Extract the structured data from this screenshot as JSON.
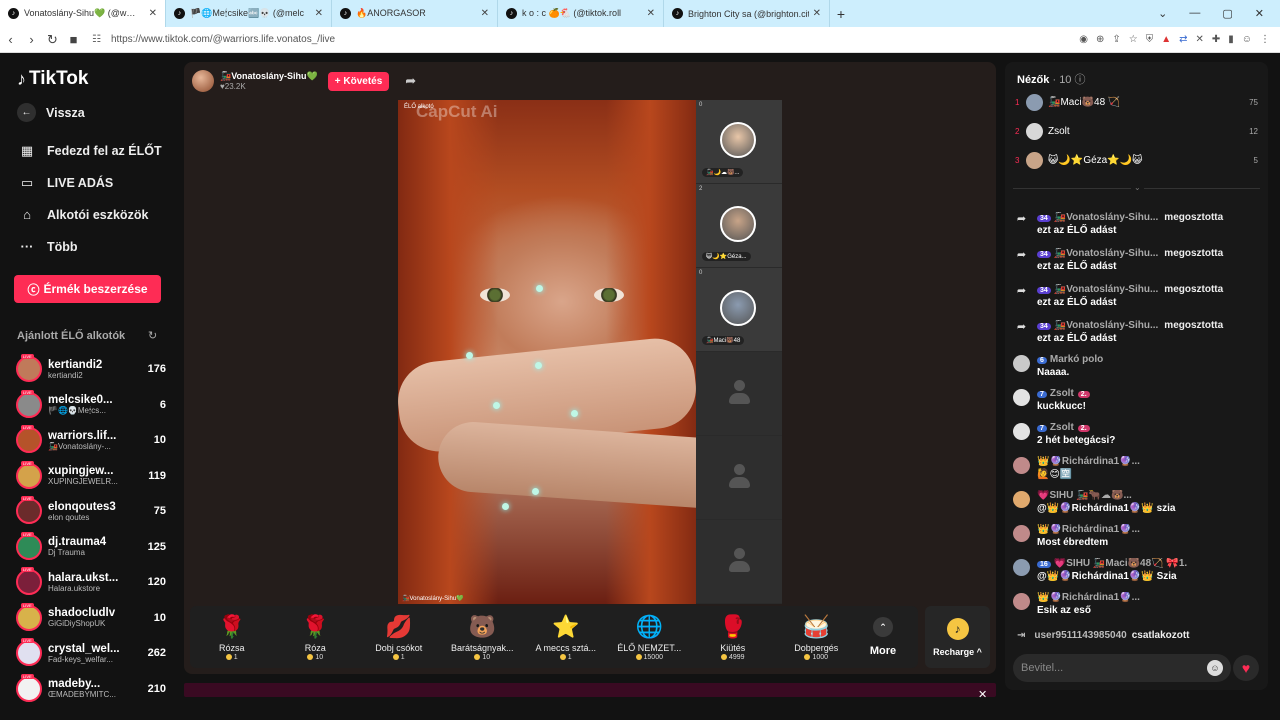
{
  "browser": {
    "tabs": [
      {
        "title": "Vonatoslány-Sihu💚 (@w…",
        "active": true
      },
      {
        "title": "🏴🌐Me🕯csike🔤💀 (@melc",
        "active": false
      },
      {
        "title": "🔥ANORGASOR",
        "active": false
      },
      {
        "title": "k o : c 🍊🐔 (@tiktok.roll",
        "active": false
      },
      {
        "title": "Brighton City sa (@brighton.city) ÉLŐ",
        "active": false
      }
    ],
    "new_tab": "+",
    "url": "https://www.tiktok.com/@warriors.life.vonatos_/live"
  },
  "sidebar": {
    "logo": "TikTok",
    "back": "Vissza",
    "nav": [
      {
        "label": "Fedezd fel az ÉLŐT",
        "icon": "calendar-icon"
      },
      {
        "label": "LIVE ADÁS",
        "icon": "video-camera-icon"
      },
      {
        "label": "Alkotói eszközök",
        "icon": "home-tools-icon"
      },
      {
        "label": "Több",
        "icon": "ellipsis-icon"
      }
    ],
    "coins_button": "Érmék beszerzése",
    "recommended_title": "Ajánlott ÉLŐ alkotók",
    "creators": [
      {
        "name": "kertiandi2",
        "sub": "kertiandi2",
        "count": "176",
        "color": "#c07a5a"
      },
      {
        "name": "melcsike0...",
        "sub": "🏴🌐💀Me🕯cs...",
        "count": "6",
        "color": "#8a8a8a"
      },
      {
        "name": "warriors.lif...",
        "sub": "🚂Vonatoslány-...",
        "count": "10",
        "color": "#b5532a"
      },
      {
        "name": "xupingjew...",
        "sub": "XUPINGJEWELR...",
        "count": "119",
        "color": "#d4a24a"
      },
      {
        "name": "elonqoutes3",
        "sub": "elon qoutes",
        "count": "75",
        "color": "#6b2b2b"
      },
      {
        "name": "dj.trauma4",
        "sub": "Dj Trauma",
        "count": "125",
        "color": "#2e8b57"
      },
      {
        "name": "halara.ukst...",
        "sub": "Halara.ukstore",
        "count": "120",
        "color": "#7b1f3a"
      },
      {
        "name": "shadocludlv",
        "sub": "GiGiDiyShopUK",
        "count": "10",
        "color": "#d8b24a"
      },
      {
        "name": "crystal_wel...",
        "sub": "Fad-keys_welfar...",
        "count": "262",
        "color": "#e0e0f0"
      },
      {
        "name": "madeby...",
        "sub": "ŒMADEBYMITC...",
        "count": "210",
        "color": "#f2f2f2"
      }
    ]
  },
  "stream": {
    "host_name": "🚂Vonatoslány-Sihu💚",
    "host_followers": "♥23.2K",
    "follow_button": "+ Követés",
    "live_label": "ÉLŐ alkotó",
    "watermark": "CapCut Ai",
    "video_footer": "🚂Vonatoslány-Sihu💚",
    "guests": [
      {
        "count": "0",
        "name": "🚂🌙☁🐻...",
        "color": "#e8c6a8"
      },
      {
        "count": "2",
        "name": "😺🌙⭐Géza...",
        "color": "#c8a488"
      },
      {
        "count": "0",
        "name": "🚂Maci🐻48",
        "color": "#8b9bb0"
      }
    ]
  },
  "gifts": [
    {
      "name": "Rózsa",
      "price": "1",
      "icon": "🌹"
    },
    {
      "name": "Róza",
      "price": "10",
      "icon": "🌹"
    },
    {
      "name": "Dobj csókot",
      "price": "1",
      "icon": "💋"
    },
    {
      "name": "Barátságnyak...",
      "price": "10",
      "icon": "🐻"
    },
    {
      "name": "A meccs sztá...",
      "price": "1",
      "icon": "⭐"
    },
    {
      "name": "ÉLŐ NEMZET...",
      "price": "15000",
      "icon": "🌐"
    },
    {
      "name": "Kiütés",
      "price": "4999",
      "icon": "🥊"
    },
    {
      "name": "Dobpergés",
      "price": "1000",
      "icon": "🥁"
    }
  ],
  "more_label": "More",
  "recharge_label": "Recharge ^",
  "viewers": {
    "title": "Nézők",
    "count": "· 10",
    "top": [
      {
        "rank": "1",
        "name": "🚂Maci🐻48 🏹",
        "score": "75",
        "color": "#8b9bb0"
      },
      {
        "rank": "2",
        "name": "Zsolt",
        "score": "12",
        "color": "#d8d8d8"
      },
      {
        "rank": "3",
        "name": "😺🌙⭐Géza⭐🌙😺",
        "score": "5",
        "color": "#c8a488"
      }
    ]
  },
  "chat": [
    {
      "type": "share",
      "level": "34",
      "user": "🚂Vonatoslány-Sihu...",
      "action": "megosztotta",
      "text": "ezt az ÉLŐ adást"
    },
    {
      "type": "share",
      "level": "34",
      "user": "🚂Vonatoslány-Sihu...",
      "action": "megosztotta",
      "text": "ezt az ÉLŐ adást"
    },
    {
      "type": "share",
      "level": "34",
      "user": "🚂Vonatoslány-Sihu...",
      "action": "megosztotta",
      "text": "ezt az ÉLŐ adást"
    },
    {
      "type": "share",
      "level": "34",
      "user": "🚂Vonatoslány-Sihu...",
      "action": "megosztotta",
      "text": "ezt az ÉLŐ adást"
    },
    {
      "type": "msg",
      "level": "6",
      "user": "Markó polo",
      "text": "Naaaa.",
      "color": "#c9c9c9"
    },
    {
      "type": "msg",
      "level": "7",
      "user": "Zsolt",
      "fan": "2.",
      "text": "kuckkucc!",
      "color": "#e2e2e2"
    },
    {
      "type": "msg",
      "level": "7",
      "user": "Zsolt",
      "fan": "2.",
      "text": "2 hét betegácsi?",
      "color": "#e2e2e2"
    },
    {
      "type": "msg",
      "level": "",
      "user": "👑🔮Richárdina1🔮...",
      "text": "🙋😊🈳",
      "color": "#c08a8a"
    },
    {
      "type": "msg",
      "level": "",
      "user": "💗SIHU 🚂🐂☁🐻...",
      "text": "@👑🔮Richárdina1🔮👑 szia",
      "color": "#e0a96d"
    },
    {
      "type": "msg",
      "level": "",
      "user": "👑🔮Richárdina1🔮...",
      "text": "Most ébredtem",
      "color": "#c08a8a"
    },
    {
      "type": "msg",
      "level": "16",
      "user": "💗SIHU 🚂Maci🐻48🏹 🎀1.",
      "text": "@👑🔮Richárdina1🔮👑 Szia",
      "color": "#8b9bb0"
    },
    {
      "type": "msg",
      "level": "",
      "user": "👑🔮Richárdina1🔮...",
      "text": "Esik az eső",
      "color": "#c08a8a"
    }
  ],
  "join": {
    "user": "user9511143985040",
    "action": "csatlakozott"
  },
  "input_placeholder": "Bevitel..."
}
